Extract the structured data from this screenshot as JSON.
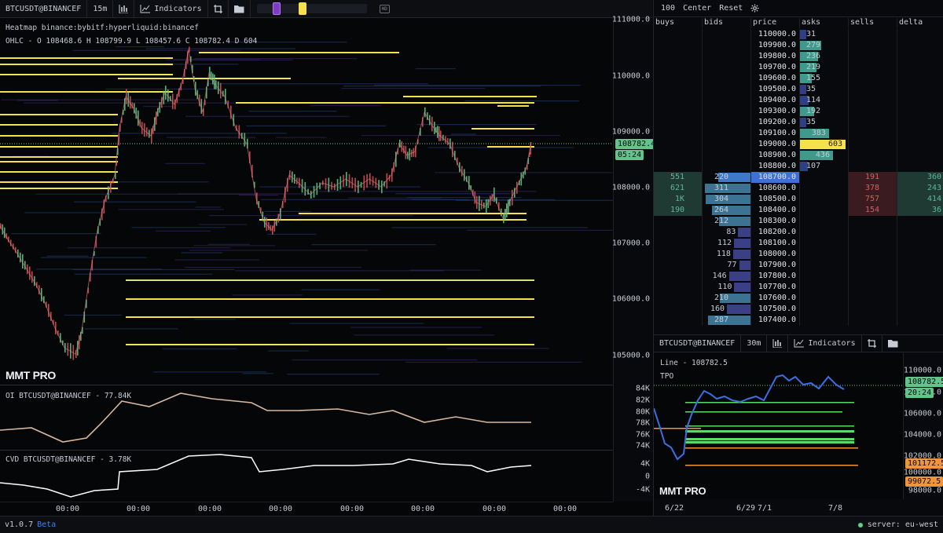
{
  "toolbar": {
    "symbol": "BTCUSDT@BINANCEF",
    "timeframe": "15m",
    "indicators": "Indicators",
    "hd": "HD",
    "range_low": 0.18,
    "range_high": 0.42
  },
  "main": {
    "heatmap_title": "Heatmap binance:bybitf:hyperliquid:binancef",
    "ohlc": "OHLC - O 108468.6 H 108799.9 L 108457.6 C 108782.4 D 604",
    "brand": "MMT PRO",
    "price_ticks": [
      "111000.0",
      "110000.0",
      "109000.0",
      "108000.0",
      "107000.0",
      "106000.0",
      "105000.0"
    ],
    "last_price": "108782.4",
    "countdown": "05:24",
    "oi_label": "OI BTCUSDT@BINANCEF - 77.84K",
    "oi_ticks": [
      "84K",
      "82K",
      "80K",
      "78K",
      "76K",
      "74K"
    ],
    "cvd_label": "CVD BTCUSDT@BINANCEF - 3.78K",
    "cvd_ticks": [
      "4K",
      "0",
      "-4K"
    ],
    "time_ticks": [
      "00:00",
      "00:00",
      "00:00",
      "00:00",
      "00:00",
      "00:00",
      "00:00",
      "00:00"
    ]
  },
  "dom": {
    "size": "100",
    "center": "Center",
    "reset": "Reset",
    "headers": [
      "buys",
      "bids",
      "price",
      "asks",
      "sells",
      "delta"
    ],
    "rows": [
      {
        "price": "110000.0",
        "ask": "31"
      },
      {
        "price": "109900.0",
        "ask": "279"
      },
      {
        "price": "109800.0",
        "ask": "236"
      },
      {
        "price": "109700.0",
        "ask": "219"
      },
      {
        "price": "109600.0",
        "ask": "155"
      },
      {
        "price": "109500.0",
        "ask": "35"
      },
      {
        "price": "109400.0",
        "ask": "114"
      },
      {
        "price": "109300.0",
        "ask": "192"
      },
      {
        "price": "109200.0",
        "ask": "35"
      },
      {
        "price": "109100.0",
        "ask": "383"
      },
      {
        "price": "109000.0",
        "ask": "603"
      },
      {
        "price": "108900.0",
        "ask": "436"
      },
      {
        "price": "108800.0",
        "ask": "107"
      },
      {
        "price": "108700.0",
        "bid": "220",
        "buy": "551",
        "sell": "191",
        "delta": "360"
      },
      {
        "price": "108600.0",
        "bid": "311",
        "buy": "621",
        "sell": "378",
        "delta": "243"
      },
      {
        "price": "108500.0",
        "bid": "304",
        "buy": "1K",
        "sell": "757",
        "delta": "414"
      },
      {
        "price": "108400.0",
        "bid": "264",
        "buy": "190",
        "sell": "154",
        "delta": "36"
      },
      {
        "price": "108300.0",
        "bid": "212"
      },
      {
        "price": "108200.0",
        "bid": "83"
      },
      {
        "price": "108100.0",
        "bid": "112"
      },
      {
        "price": "108000.0",
        "bid": "118"
      },
      {
        "price": "107900.0",
        "bid": "77"
      },
      {
        "price": "107800.0",
        "bid": "146"
      },
      {
        "price": "107700.0",
        "bid": "110"
      },
      {
        "price": "107600.0",
        "bid": "210"
      },
      {
        "price": "107500.0",
        "bid": "160"
      },
      {
        "price": "107400.0",
        "bid": "287"
      }
    ]
  },
  "mini": {
    "symbol": "BTCUSDT@BINANCEF",
    "timeframe": "30m",
    "indicators": "Indicators",
    "line_label": "Line - 108782.5",
    "tpo": "TPO",
    "brand": "MMT PRO",
    "price_ticks": [
      "110000.0",
      "108000.0",
      "106000.0",
      "104000.0",
      "102000.0",
      "100000.0",
      "98000.0"
    ],
    "last_price": "108782.5",
    "countdown": "20:24",
    "level1": "101172.5",
    "level2": "99072.5",
    "date_ticks": [
      "6/22",
      "6/29",
      "7/1",
      "7/8"
    ]
  },
  "status": {
    "version": "v1.0.7",
    "beta": "Beta",
    "server": "server: eu-west"
  },
  "colors": {
    "yellow": "#f5e14a",
    "green": "#5fd08a",
    "red": "#e0545a",
    "ask": "#3f9a8c",
    "bid": "#3e6e9a",
    "accent": "#3b82f6"
  }
}
